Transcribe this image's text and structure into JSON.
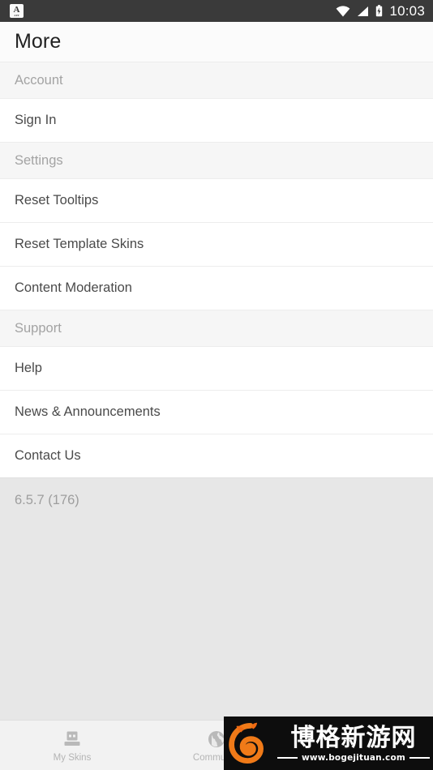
{
  "statusbar": {
    "notification_icon": "app-badge-icon",
    "notification_letter": "A",
    "notification_sub": "APP",
    "wifi_icon": "wifi-icon",
    "signal_icon": "cell-signal-icon",
    "battery_icon": "battery-charging-icon",
    "time": "10:03",
    "background_color": "#3a3a3a"
  },
  "appbar": {
    "title": "More",
    "background_color": "#fbfbfb"
  },
  "sections": [
    {
      "header": "Account",
      "items": [
        {
          "label": "Sign In"
        }
      ]
    },
    {
      "header": "Settings",
      "items": [
        {
          "label": "Reset Tooltips"
        },
        {
          "label": "Reset Template Skins"
        },
        {
          "label": "Content Moderation"
        }
      ]
    },
    {
      "header": "Support",
      "items": [
        {
          "label": "Help"
        },
        {
          "label": "News & Announcements"
        },
        {
          "label": "Contact Us"
        }
      ]
    }
  ],
  "version": {
    "label": "6.5.7 (176)"
  },
  "bottomnav": {
    "items": [
      {
        "label": "My Skins",
        "icon": "skin-avatar-icon"
      },
      {
        "label": "Community",
        "icon": "globe-icon"
      }
    ],
    "background_color": "#f2f2f2",
    "inactive_color": "#b4b4b4"
  },
  "watermark": {
    "site_name": "博格新游网",
    "url": "www.bogejituan.com",
    "logo_icon": "fox-swirl-logo-icon",
    "logo_color": "#f07a18",
    "background_color": "#0d0d0d"
  }
}
